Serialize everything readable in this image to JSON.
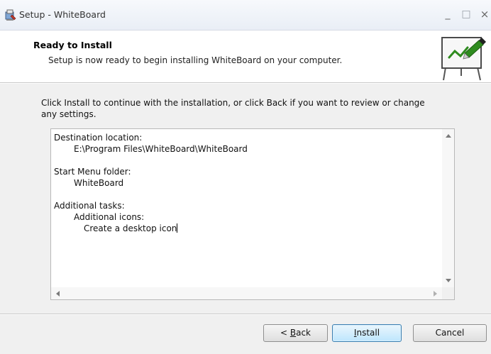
{
  "window": {
    "title": "Setup - WhiteBoard",
    "controls": {
      "minimize": "_",
      "maximize": "□",
      "close": "×"
    }
  },
  "header": {
    "title": "Ready to Install",
    "subtitle": "Setup is now ready to begin installing WhiteBoard on your computer.",
    "logo_icon": "whiteboard-easel-icon"
  },
  "body": {
    "intro": "Click Install to continue with the installation, or click Back if you want to review or change any settings."
  },
  "summary": {
    "destination_label": "Destination location:",
    "destination_value": "E:\\Program Files\\WhiteBoard\\WhiteBoard",
    "start_menu_label": "Start Menu folder:",
    "start_menu_value": "WhiteBoard",
    "tasks_label": "Additional tasks:",
    "tasks_group": "Additional icons:",
    "tasks_item": "Create a desktop icon"
  },
  "buttons": {
    "back_prefix": "< ",
    "back_hotkey": "B",
    "back_rest": "ack",
    "install_hotkey": "I",
    "install_rest": "nstall",
    "cancel": "Cancel"
  },
  "colors": {
    "window_bg": "#f0f0f0",
    "header_bg": "#ffffff",
    "default_button_border": "#3c7fb1",
    "logo_marker_green": "#2e8b1e"
  }
}
